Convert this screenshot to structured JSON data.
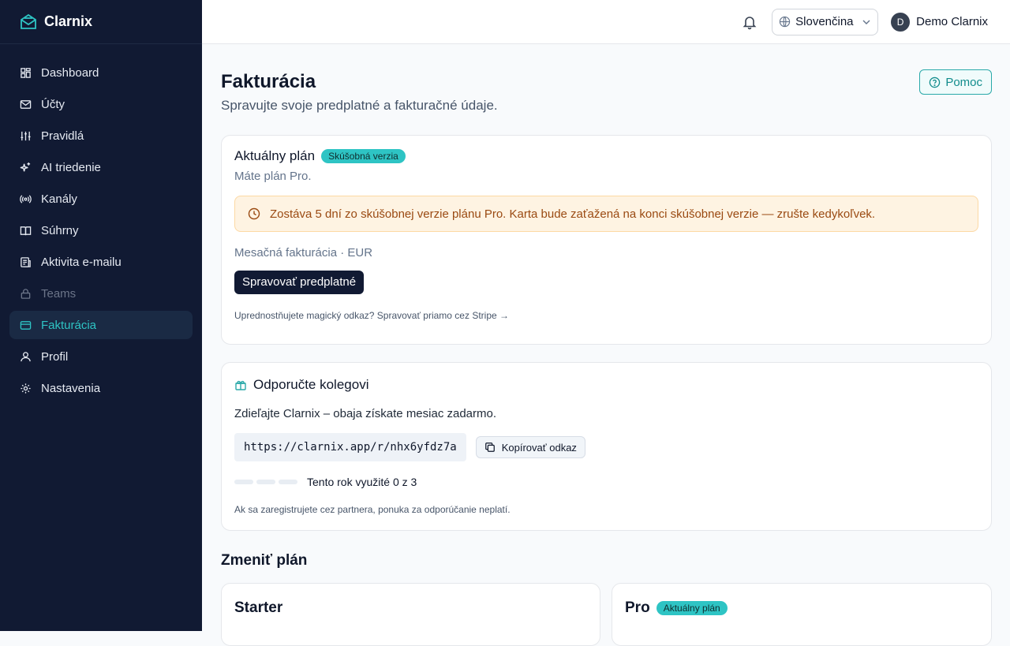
{
  "brand": {
    "name": "Clarnix"
  },
  "sidebar": {
    "items": [
      {
        "label": "Dashboard",
        "icon": "dashboard-icon",
        "state": "normal"
      },
      {
        "label": "Účty",
        "icon": "mail-icon",
        "state": "normal"
      },
      {
        "label": "Pravidlá",
        "icon": "sliders-icon",
        "state": "normal"
      },
      {
        "label": "AI triedenie",
        "icon": "sparkles-icon",
        "state": "normal"
      },
      {
        "label": "Kanály",
        "icon": "radio-icon",
        "state": "normal"
      },
      {
        "label": "Súhrny",
        "icon": "book-icon",
        "state": "normal"
      },
      {
        "label": "Aktivita e-mailu",
        "icon": "activity-icon",
        "state": "normal"
      },
      {
        "label": "Teams",
        "icon": "lock-icon",
        "state": "disabled"
      },
      {
        "label": "Fakturácia",
        "icon": "credit-card-icon",
        "state": "active"
      },
      {
        "label": "Profil",
        "icon": "user-icon",
        "state": "normal"
      },
      {
        "label": "Nastavenia",
        "icon": "gear-icon",
        "state": "normal"
      }
    ]
  },
  "topbar": {
    "language": "Slovenčina",
    "user_initial": "D",
    "user_name": "Demo Clarnix"
  },
  "page": {
    "title": "Fakturácia",
    "subtitle": "Spravujte svoje predplatné a fakturačné údaje.",
    "help_label": "Pomoc"
  },
  "current_plan": {
    "heading": "Aktuálny plán",
    "badge": "Skúšobná verzia",
    "plan_text": "Máte plán Pro.",
    "alert": "Zostáva 5 dní zo skúšobnej verzie plánu Pro. Karta bude zaťažená na konci skúšobnej verzie — zrušte kedykoľvek.",
    "billing_info": "Mesačná fakturácia · EUR",
    "manage_button": "Spravovať predplatné",
    "magic_link": "Uprednostňujete magický odkaz? Spravovať priamo cez Stripe →"
  },
  "referral": {
    "heading": "Odporučte kolegovi",
    "text": "Zdieľajte Clarnix – obaja získate mesiac zadarmo.",
    "link": "https://clarnix.app/r/nhx6yfdz7a",
    "copy_label": "Kopírovať odkaz",
    "usage": "Tento rok využité 0 z 3",
    "used": 0,
    "total": 3,
    "note": "Ak sa zaregistrujete cez partnera, ponuka za odporúčanie neplatí."
  },
  "change_plan": {
    "title": "Zmeniť plán",
    "plans": [
      {
        "name": "Starter",
        "badge": ""
      },
      {
        "name": "Pro",
        "badge": "Aktuálny plán"
      }
    ]
  },
  "colors": {
    "sidebar_bg": "#111a33",
    "accent": "#2ec4c4",
    "alert_bg": "#fef3e2"
  }
}
